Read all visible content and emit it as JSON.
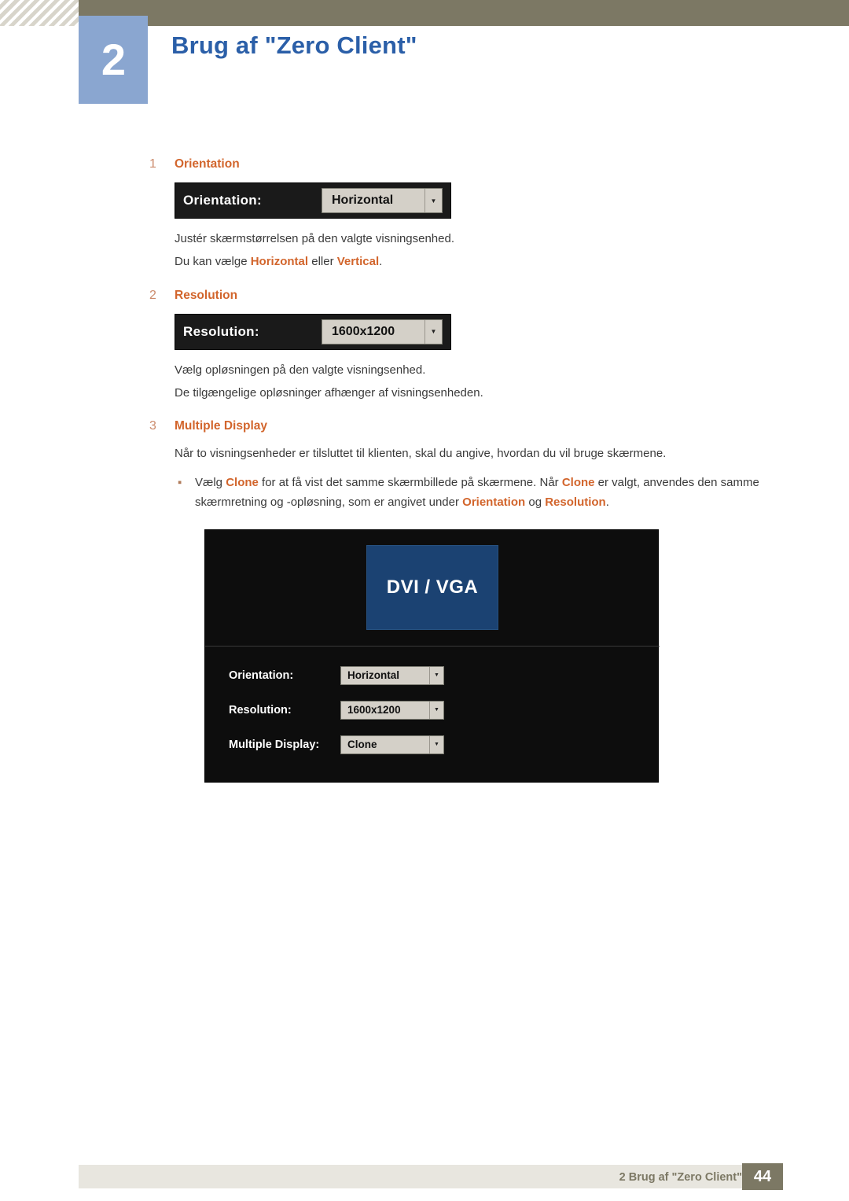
{
  "header": {
    "chapter_number": "2",
    "chapter_title": "Brug af \"Zero Client\"",
    "accent_color": "#2b5fa8",
    "badge_color": "#8aa6d0",
    "bar_color": "#7c7864"
  },
  "items": [
    {
      "num": "1",
      "label": "Orientation",
      "widget": {
        "label": "Orientation:",
        "value": "Horizontal",
        "arrow": "chevron-down-icon"
      },
      "paragraphs": [
        "Justér skærmstørrelsen på den valgte visningsenhed.",
        "Du kan vælge Horizontal eller Vertical."
      ],
      "para2_parts": {
        "pre": "Du kan vælge ",
        "b1": "Horizontal",
        "mid": " eller ",
        "b2": "Vertical",
        "post": "."
      }
    },
    {
      "num": "2",
      "label": "Resolution",
      "widget": {
        "label": "Resolution:",
        "value": "1600x1200",
        "arrow": "chevron-down-icon"
      },
      "paragraphs": [
        "Vælg opløsningen på den valgte visningsenhed.",
        "De tilgængelige opløsninger afhænger af visningsenheden."
      ]
    },
    {
      "num": "3",
      "label": "Multiple Display",
      "paragraphs": [
        "Når to visningsenheder er tilsluttet til klienten, skal du angive, hvordan du vil bruge skærmene."
      ]
    }
  ],
  "bullet": {
    "marker": "▪",
    "p1": "Vælg ",
    "b_clone1": "Clone",
    "p2": " for at få vist det samme skærmbillede på skærmene. Når ",
    "b_clone2": "Clone",
    "p3": " er valgt, anvendes den samme skærmretning og -opløsning, som er angivet under ",
    "b_orientation": "Orientation",
    "p4": " og ",
    "b_resolution": "Resolution",
    "p5": "."
  },
  "dialog": {
    "preview_label": "DVI / VGA",
    "rows": [
      {
        "label": "Orientation:",
        "value": "Horizontal"
      },
      {
        "label": "Resolution:",
        "value": "1600x1200"
      },
      {
        "label": "Multiple Display:",
        "value": "Clone"
      }
    ],
    "arrow_icon": "chevron-down-icon"
  },
  "footer": {
    "text": "2 Brug af \"Zero Client\"",
    "page": "44"
  },
  "colors": {
    "orange": "#d2652c",
    "blue": "#2b5fa8",
    "olive": "#7c7864"
  }
}
